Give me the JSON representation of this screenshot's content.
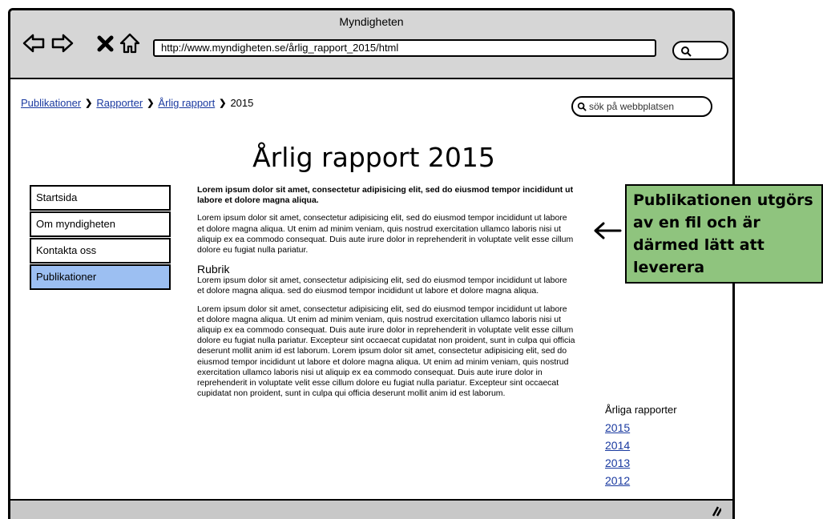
{
  "window": {
    "title": "Myndigheten"
  },
  "browser": {
    "url": "http://www.myndigheten.se/årlig_rapport_2015/html",
    "icons": [
      "back-icon",
      "forward-icon",
      "close-icon",
      "home-icon",
      "search-icon"
    ]
  },
  "breadcrumb": {
    "items": [
      "Publikationer",
      "Rapporter",
      "Årlig rapport"
    ],
    "current": "2015"
  },
  "site_search": {
    "placeholder": "sök på webbplatsen"
  },
  "page": {
    "title": "Årlig rapport 2015"
  },
  "side_nav": {
    "items": [
      "Startsida",
      "Om myndigheten",
      "Kontakta oss",
      "Publikationer"
    ],
    "active": "Publikationer",
    "active_color": "#9cbff2"
  },
  "main": {
    "lead": "Lorem ipsum dolor sit amet, consectetur adipisicing elit, sed do eiusmod tempor incididunt ut labore et dolore magna aliqua.",
    "para1": "Lorem ipsum dolor sit amet, consectetur adipisicing elit, sed do eiusmod tempor incididunt ut labore et dolore magna aliqua. Ut enim ad minim veniam, quis nostrud exercitation ullamco laboris nisi ut aliquip ex ea commodo consequat. Duis aute irure dolor in reprehenderit in voluptate velit esse cillum dolore eu fugiat nulla pariatur.",
    "subheading": "Rubrik",
    "para2": "Lorem ipsum dolor sit amet, consectetur adipisicing elit, sed do eiusmod tempor incididunt ut labore et dolore magna aliqua. sed do eiusmod tempor incididunt ut labore et dolore magna aliqua.",
    "para3": "Lorem ipsum dolor sit amet, consectetur adipisicing elit, sed do eiusmod tempor incididunt ut labore et dolore magna aliqua. Ut enim ad minim veniam, quis nostrud exercitation ullamco laboris nisi ut aliquip ex ea commodo consequat. Duis aute irure dolor in reprehenderit in voluptate velit esse cillum dolore eu fugiat nulla pariatur. Excepteur sint occaecat cupidatat non proident, sunt in culpa qui officia deserunt mollit anim id est laborum. Lorem ipsum dolor sit amet, consectetur adipisicing elit, sed do eiusmod tempor incididunt ut labore et dolore magna aliqua. Ut enim ad minim veniam, quis nostrud exercitation ullamco laboris nisi ut aliquip ex ea commodo consequat. Duis aute irure dolor in reprehenderit in voluptate velit esse cillum dolore eu fugiat nulla pariatur. Excepteur sint occaecat cupidatat non proident, sunt in culpa qui officia deserunt mollit anim id est laborum."
  },
  "reports": {
    "title": "Årliga rapporter",
    "years": [
      "2015",
      "2014",
      "2013",
      "2012"
    ]
  },
  "callout": {
    "text": "Publikationen utgörs av en fil och är därmed lätt att leverera",
    "color": "#8fc47e"
  }
}
